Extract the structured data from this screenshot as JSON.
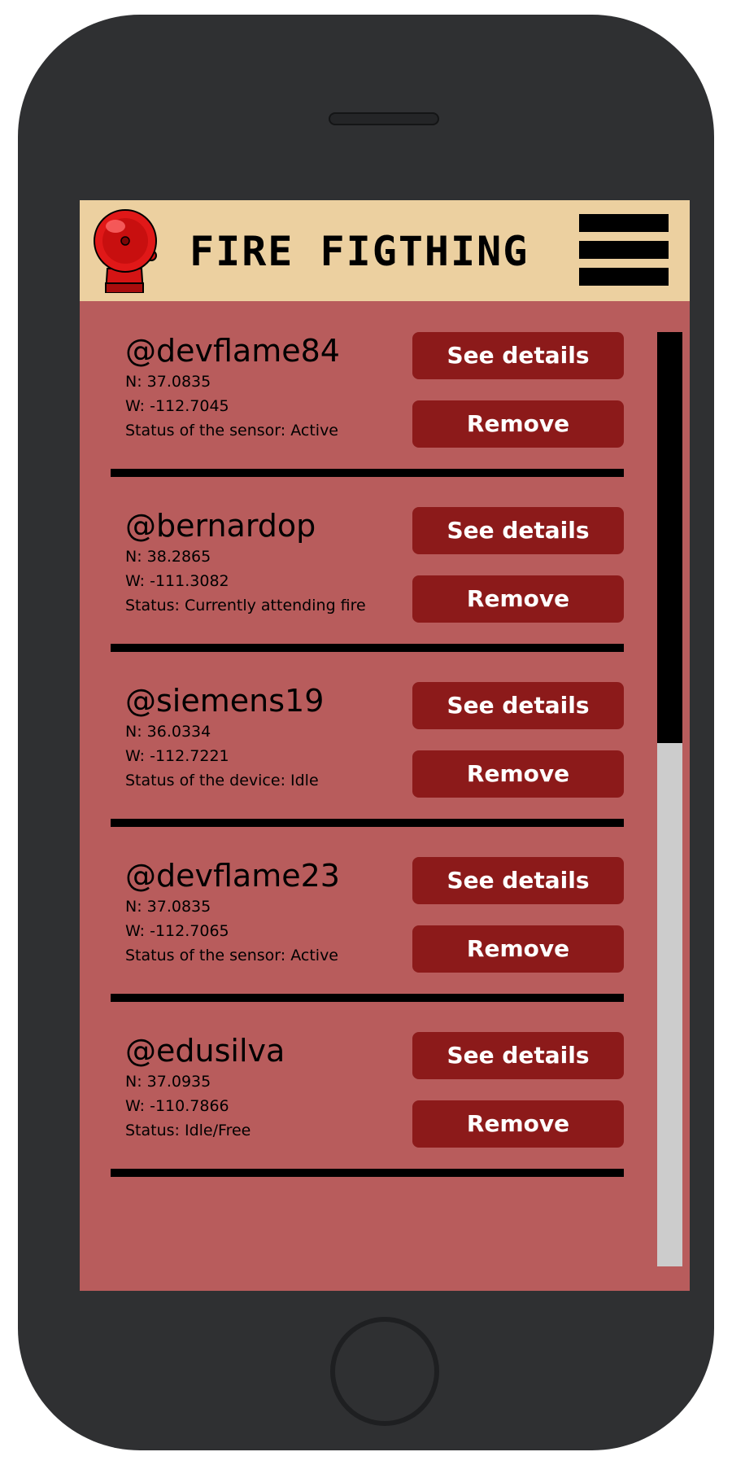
{
  "app": {
    "title": "FIRE FIGTHING",
    "menu_icon": "hamburger-menu-icon",
    "logo_icon": "fire-alarm-bell-icon"
  },
  "colors": {
    "phone_body": "#2f3032",
    "header_bg": "#ecd0a0",
    "content_bg": "#b85c5c",
    "button_bg": "#8c1a1a",
    "button_text": "#ffffff",
    "scroll_track": "#cccccc",
    "scroll_thumb": "#000000"
  },
  "actions": {
    "details_label": "See details",
    "remove_label": "Remove"
  },
  "devices": [
    {
      "name": "@devflame84",
      "north": "N: 37.0835",
      "west": "W: -112.7045",
      "status": "Status of the sensor: Active"
    },
    {
      "name": "@bernardop",
      "north": "N: 38.2865",
      "west": "W: -111.3082",
      "status": "Status: Currently attending fire"
    },
    {
      "name": "@siemens19",
      "north": "N: 36.0334",
      "west": "W: -112.7221",
      "status": "Status of the device: Idle"
    },
    {
      "name": "@devflame23",
      "north": "N: 37.0835",
      "west": "W: -112.7065",
      "status": "Status of the sensor: Active"
    },
    {
      "name": "@edusilva",
      "north": "N: 37.0935",
      "west": "W: -110.7866",
      "status": "Status: Idle/Free"
    }
  ],
  "scrollbar": {
    "position_fraction": 0.0,
    "visible_fraction": 0.44
  }
}
